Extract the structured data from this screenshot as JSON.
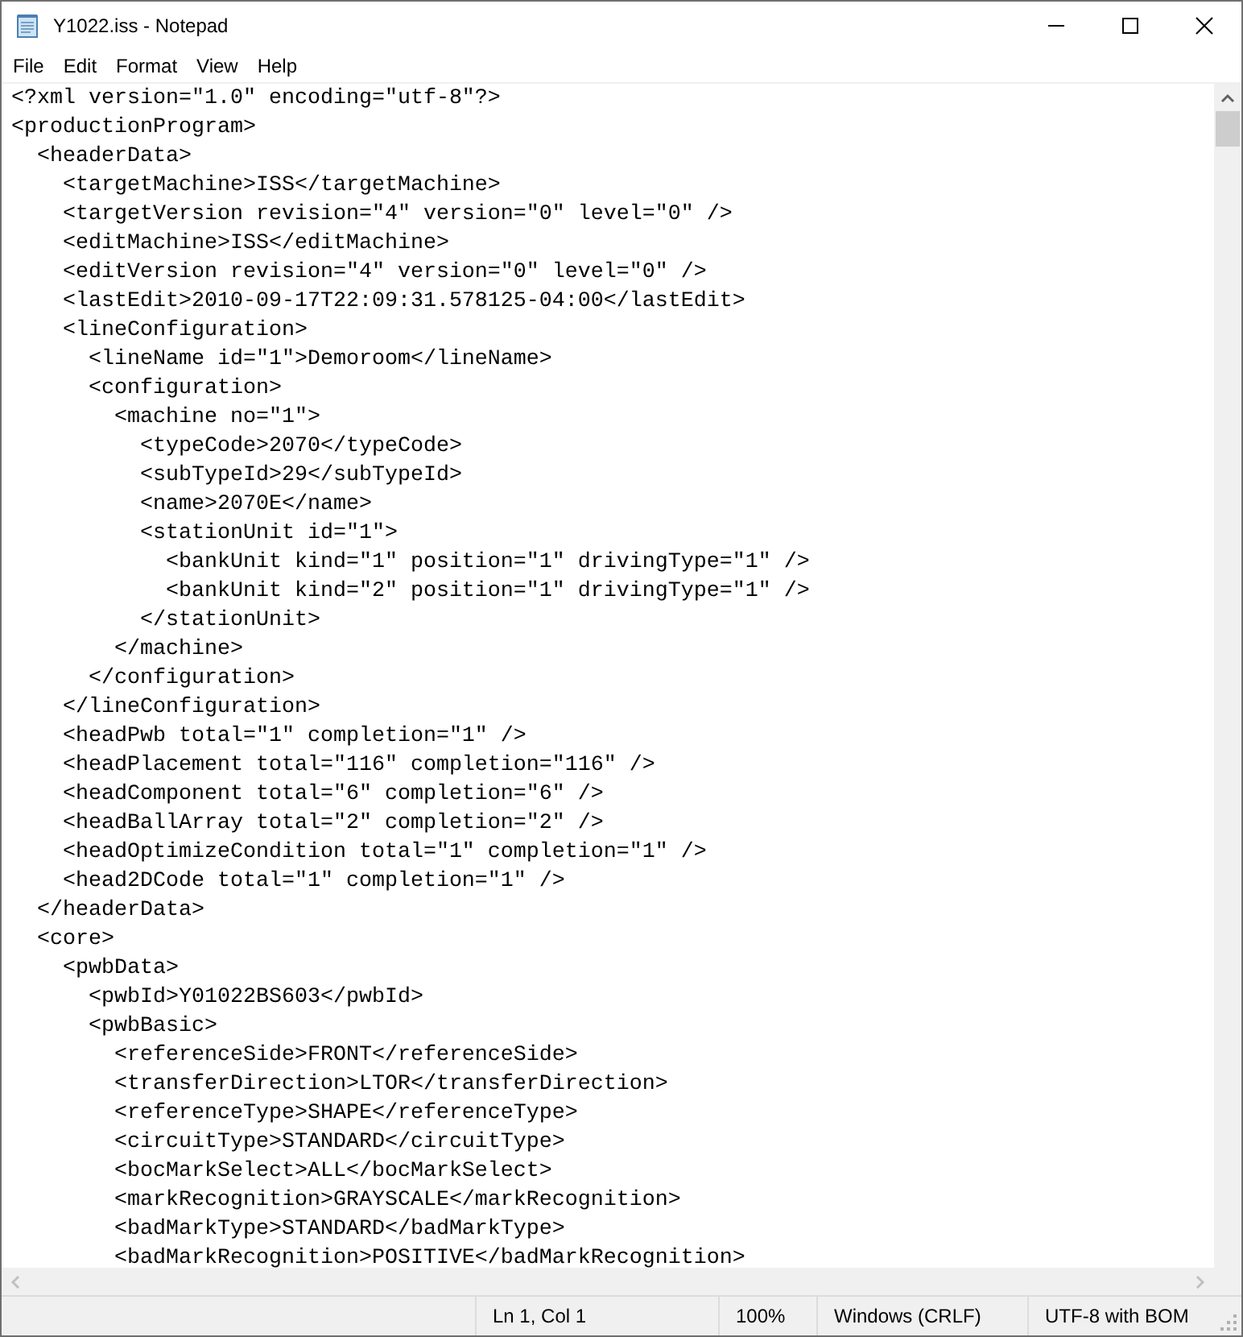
{
  "window": {
    "title": "Y1022.iss - Notepad"
  },
  "menu": [
    "File",
    "Edit",
    "Format",
    "View",
    "Help"
  ],
  "editor": {
    "lines": [
      "<?xml version=\"1.0\" encoding=\"utf-8\"?>",
      "<productionProgram>",
      "  <headerData>",
      "    <targetMachine>ISS</targetMachine>",
      "    <targetVersion revision=\"4\" version=\"0\" level=\"0\" />",
      "    <editMachine>ISS</editMachine>",
      "    <editVersion revision=\"4\" version=\"0\" level=\"0\" />",
      "    <lastEdit>2010-09-17T22:09:31.578125-04:00</lastEdit>",
      "    <lineConfiguration>",
      "      <lineName id=\"1\">Demoroom</lineName>",
      "      <configuration>",
      "        <machine no=\"1\">",
      "          <typeCode>2070</typeCode>",
      "          <subTypeId>29</subTypeId>",
      "          <name>2070E</name>",
      "          <stationUnit id=\"1\">",
      "            <bankUnit kind=\"1\" position=\"1\" drivingType=\"1\" />",
      "            <bankUnit kind=\"2\" position=\"1\" drivingType=\"1\" />",
      "          </stationUnit>",
      "        </machine>",
      "      </configuration>",
      "    </lineConfiguration>",
      "    <headPwb total=\"1\" completion=\"1\" />",
      "    <headPlacement total=\"116\" completion=\"116\" />",
      "    <headComponent total=\"6\" completion=\"6\" />",
      "    <headBallArray total=\"2\" completion=\"2\" />",
      "    <headOptimizeCondition total=\"1\" completion=\"1\" />",
      "    <head2DCode total=\"1\" completion=\"1\" />",
      "  </headerData>",
      "  <core>",
      "    <pwbData>",
      "      <pwbId>Y01022BS603</pwbId>",
      "      <pwbBasic>",
      "        <referenceSide>FRONT</referenceSide>",
      "        <transferDirection>LTOR</transferDirection>",
      "        <referenceType>SHAPE</referenceType>",
      "        <circuitType>STANDARD</circuitType>",
      "        <bocMarkSelect>ALL</bocMarkSelect>",
      "        <markRecognition>GRAYSCALE</markRecognition>",
      "        <badMarkType>STANDARD</badMarkType>",
      "        <badMarkRecognition>POSITIVE</badMarkRecognition>"
    ]
  },
  "status_bar": [
    "Ln 1, Col 1",
    "100%",
    "Windows (CRLF)",
    "UTF-8 with BOM"
  ]
}
